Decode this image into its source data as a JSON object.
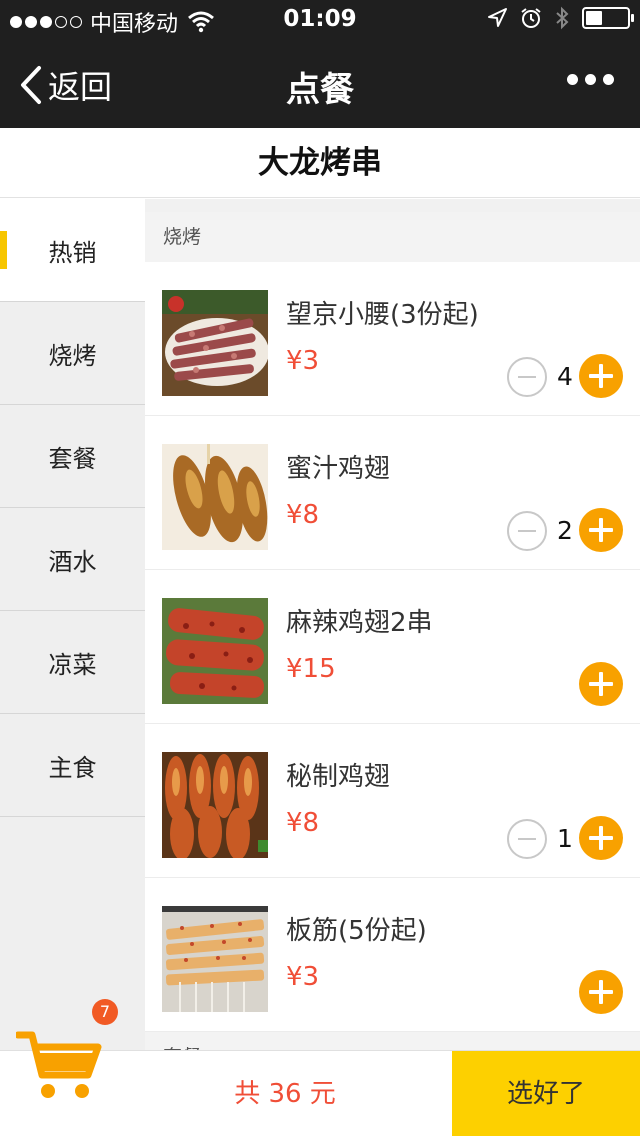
{
  "status_bar": {
    "carrier": "中国移动",
    "time": "01:09",
    "battery_level": 0.4
  },
  "nav": {
    "back_label": "返回",
    "title": "点餐"
  },
  "store": {
    "name": "大龙烤串"
  },
  "categories": [
    {
      "label": "热销"
    },
    {
      "label": "烧烤"
    },
    {
      "label": "套餐"
    },
    {
      "label": "酒水"
    },
    {
      "label": "凉菜"
    },
    {
      "label": "主食"
    }
  ],
  "sections": [
    {
      "title": "烧烤"
    },
    {
      "title": "套餐"
    }
  ],
  "items": [
    {
      "name": "望京小腰(3份起)",
      "price": "¥3",
      "quantity": "4",
      "image": "grilled-kidney-skewers"
    },
    {
      "name": "蜜汁鸡翅",
      "price": "¥8",
      "quantity": "2",
      "image": "honey-chicken-wings"
    },
    {
      "name": "麻辣鸡翅2串",
      "price": "¥15",
      "quantity": "",
      "image": "spicy-chicken-wing-skewers"
    },
    {
      "name": "秘制鸡翅",
      "price": "¥8",
      "quantity": "1",
      "image": "secret-recipe-chicken-wings"
    },
    {
      "name": "板筋(5份起)",
      "price": "¥3",
      "quantity": "",
      "image": "beef-tendon-skewers"
    }
  ],
  "cart": {
    "count": "7",
    "total": "共 36 元",
    "confirm_label": "选好了"
  },
  "colors": {
    "accent_orange": "#f8a100",
    "price_red": "#f04e37",
    "confirm_yellow": "#fdd000",
    "nav_dark": "#1f1f1f"
  }
}
